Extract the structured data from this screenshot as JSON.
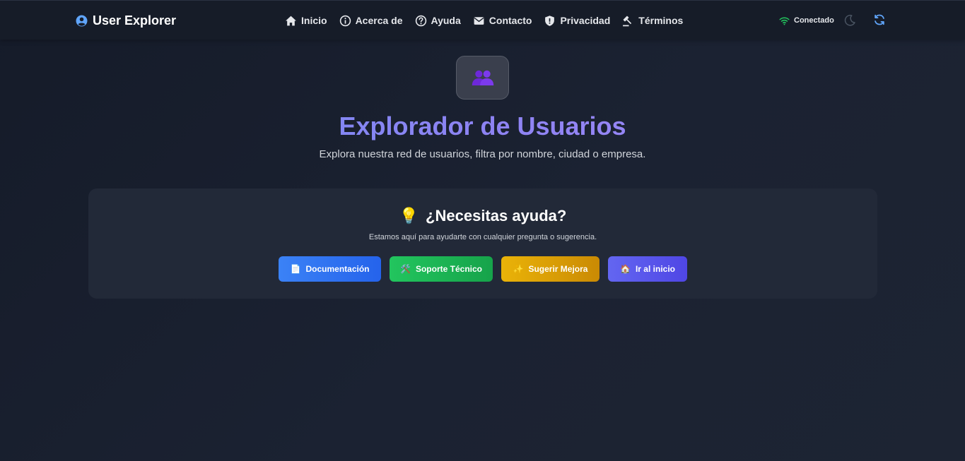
{
  "navbar": {
    "brand": "User Explorer",
    "links": [
      {
        "label": "Inicio",
        "icon": "home-icon"
      },
      {
        "label": "Acerca de",
        "icon": "info-icon"
      },
      {
        "label": "Ayuda",
        "icon": "question-icon"
      },
      {
        "label": "Contacto",
        "icon": "envelope-icon"
      },
      {
        "label": "Privacidad",
        "icon": "shield-icon"
      },
      {
        "label": "Términos",
        "icon": "gavel-icon"
      }
    ],
    "status": "Conectado",
    "status_color": "#22c55e",
    "accent_color": "#60a5fa"
  },
  "hero": {
    "icon": "users-icon",
    "title": "Explorador de Usuarios",
    "subtitle": "Explora nuestra red de usuarios, filtra por nombre, ciudad o empresa."
  },
  "help": {
    "emoji": "💡",
    "title": "¿Necesitas ayuda?",
    "subtitle": "Estamos aquí para ayudarte con cualquier pregunta o sugerencia.",
    "buttons": [
      {
        "emoji": "📄",
        "label": "Documentación",
        "color": "#3b82f6"
      },
      {
        "emoji": "🛠️",
        "label": "Soporte Técnico",
        "color": "#22c55e"
      },
      {
        "emoji": "✨",
        "label": "Sugerir Mejora",
        "color": "#eab308"
      },
      {
        "emoji": "🏠",
        "label": "Ir al inicio",
        "color": "#6366f1"
      }
    ]
  }
}
